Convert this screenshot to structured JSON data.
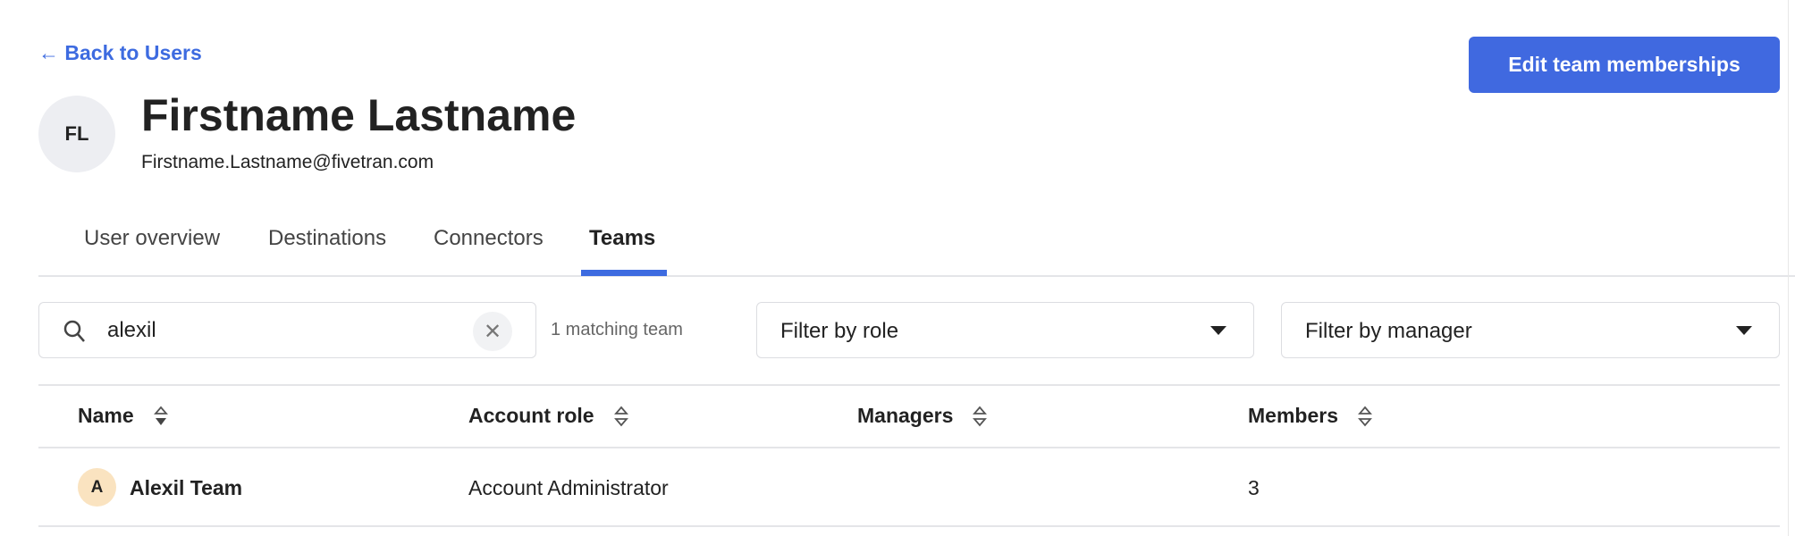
{
  "header": {
    "back_label": "Back to Users",
    "edit_button": "Edit team memberships"
  },
  "user": {
    "initials": "FL",
    "name": "Firstname Lastname",
    "email": "Firstname.Lastname@fivetran.com"
  },
  "tabs": [
    {
      "label": "User overview"
    },
    {
      "label": "Destinations"
    },
    {
      "label": "Connectors"
    },
    {
      "label": "Teams",
      "active": true
    }
  ],
  "accent": "#4069e0",
  "filters": {
    "search_value": "alexil",
    "match_count": "1 matching team",
    "role_placeholder": "Filter by role",
    "manager_placeholder": "Filter by manager"
  },
  "table": {
    "columns": [
      {
        "label": "Name",
        "sort": "descending"
      },
      {
        "label": "Account role",
        "sort": "none"
      },
      {
        "label": "Managers",
        "sort": "none"
      },
      {
        "label": "Members",
        "sort": "none"
      }
    ],
    "rows": [
      {
        "initial": "A",
        "name": "Alexil Team",
        "role": "Account Administrator",
        "managers": "",
        "members": "3"
      }
    ]
  }
}
